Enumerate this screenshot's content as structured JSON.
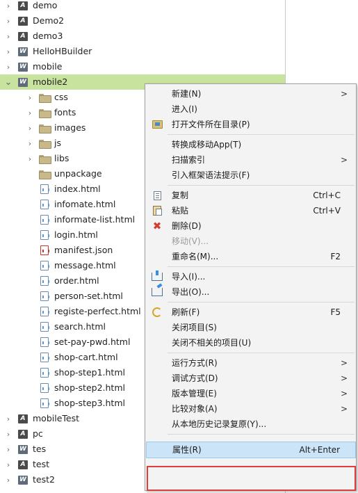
{
  "tree": {
    "items": [
      {
        "label": "demo",
        "kind": "project-a",
        "chevron": "right"
      },
      {
        "label": "Demo2",
        "kind": "project-a",
        "chevron": "right"
      },
      {
        "label": "demo3",
        "kind": "project-a",
        "chevron": "right"
      },
      {
        "label": "HelloHBuilder",
        "kind": "project-w",
        "chevron": "right"
      },
      {
        "label": "mobile",
        "kind": "project-w",
        "chevron": "right"
      },
      {
        "label": "mobile2",
        "kind": "project-w",
        "chevron": "down",
        "selected": true
      },
      {
        "label": "css",
        "kind": "folder",
        "chevron": "right"
      },
      {
        "label": "fonts",
        "kind": "folder",
        "chevron": "right"
      },
      {
        "label": "images",
        "kind": "folder",
        "chevron": "right"
      },
      {
        "label": "js",
        "kind": "folder",
        "chevron": "right"
      },
      {
        "label": "libs",
        "kind": "folder",
        "chevron": "right"
      },
      {
        "label": "unpackage",
        "kind": "folder",
        "chevron": ""
      },
      {
        "label": "index.html",
        "kind": "file",
        "chevron": ""
      },
      {
        "label": "infomate.html",
        "kind": "file",
        "chevron": ""
      },
      {
        "label": "informate-list.html",
        "kind": "file",
        "chevron": ""
      },
      {
        "label": "login.html",
        "kind": "file",
        "chevron": ""
      },
      {
        "label": "manifest.json",
        "kind": "json",
        "chevron": ""
      },
      {
        "label": "message.html",
        "kind": "file",
        "chevron": ""
      },
      {
        "label": "order.html",
        "kind": "file",
        "chevron": ""
      },
      {
        "label": "person-set.html",
        "kind": "file",
        "chevron": ""
      },
      {
        "label": "registe-perfect.html",
        "kind": "file",
        "chevron": ""
      },
      {
        "label": "search.html",
        "kind": "file",
        "chevron": ""
      },
      {
        "label": "set-pay-pwd.html",
        "kind": "file",
        "chevron": ""
      },
      {
        "label": "shop-cart.html",
        "kind": "file",
        "chevron": ""
      },
      {
        "label": "shop-step1.html",
        "kind": "file",
        "chevron": ""
      },
      {
        "label": "shop-step2.html",
        "kind": "file",
        "chevron": ""
      },
      {
        "label": "shop-step3.html",
        "kind": "file",
        "chevron": ""
      },
      {
        "label": "mobileTest",
        "kind": "project-a",
        "chevron": "right"
      },
      {
        "label": "pc",
        "kind": "project-a",
        "chevron": "right"
      },
      {
        "label": "tes",
        "kind": "project-w",
        "chevron": "right"
      },
      {
        "label": "test",
        "kind": "project-a",
        "chevron": "right"
      },
      {
        "label": "test2",
        "kind": "project-w",
        "chevron": "right"
      }
    ]
  },
  "context_menu": {
    "items": [
      {
        "label": "新建(N)",
        "submenu": true
      },
      {
        "label": "进入(I)"
      },
      {
        "label": "打开文件所在目录(P)",
        "icon": "folder-open-icon"
      },
      {
        "separator": true
      },
      {
        "label": "转换成移动App(T)"
      },
      {
        "label": "扫描索引",
        "submenu": true
      },
      {
        "label": "引入框架语法提示(F)"
      },
      {
        "separator": true
      },
      {
        "label": "复制",
        "shortcut": "Ctrl+C",
        "icon": "copy-icon"
      },
      {
        "label": "粘贴",
        "shortcut": "Ctrl+V",
        "icon": "paste-icon"
      },
      {
        "label": "删除(D)",
        "icon": "delete-icon"
      },
      {
        "label": "移动(V)...",
        "disabled": true
      },
      {
        "label": "重命名(M)...",
        "shortcut": "F2"
      },
      {
        "separator": true
      },
      {
        "label": "导入(I)...",
        "icon": "import-icon"
      },
      {
        "label": "导出(O)...",
        "icon": "export-icon"
      },
      {
        "separator": true
      },
      {
        "label": "刷新(F)",
        "shortcut": "F5",
        "icon": "refresh-icon"
      },
      {
        "label": "关闭项目(S)"
      },
      {
        "label": "关闭不相关的项目(U)"
      },
      {
        "separator": true
      },
      {
        "label": "运行方式(R)",
        "submenu": true
      },
      {
        "label": "调试方式(D)",
        "submenu": true
      },
      {
        "label": "版本管理(E)",
        "submenu": true
      },
      {
        "label": "比较对象(A)",
        "submenu": true
      },
      {
        "label": "从本地历史记录复原(Y)..."
      },
      {
        "separator": true
      },
      {
        "label": "属性(R)",
        "shortcut": "Alt+Enter",
        "highlighted": true
      }
    ]
  },
  "glyphs": {
    "chevron_right": "›",
    "chevron_down": "⌄",
    "submenu_arrow": ">",
    "delete_x": "✖",
    "project_letter": "A",
    "project_w_letter": "W"
  },
  "colors": {
    "selection": "#c7e39e",
    "menu_bg": "#f3f3f3",
    "menu_hover": "#cce4f7",
    "annotation_box": "#e23b3b"
  }
}
